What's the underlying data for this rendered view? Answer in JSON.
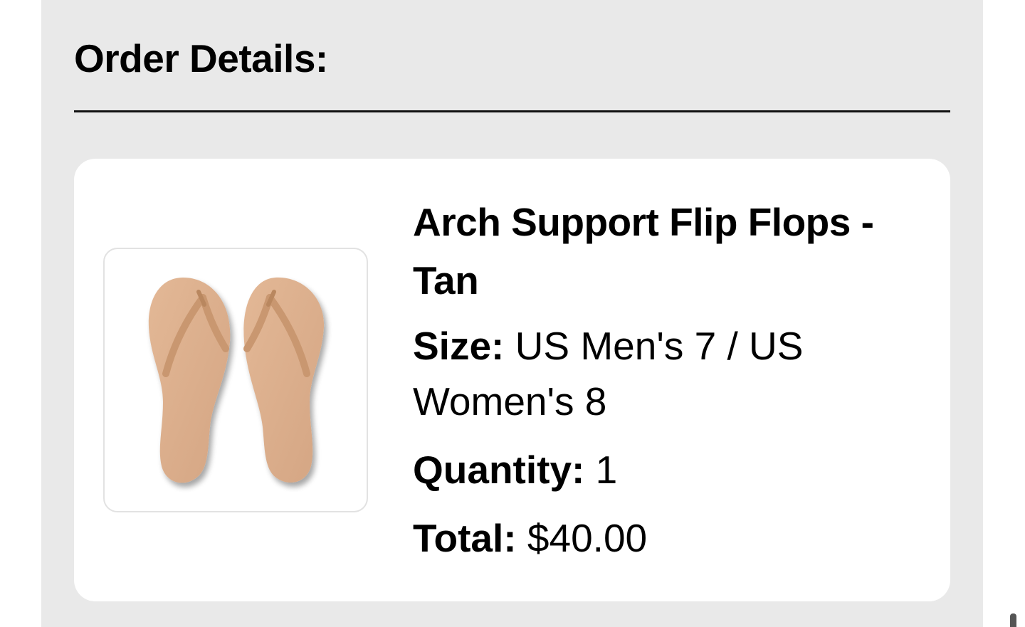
{
  "order": {
    "heading": "Order Details:",
    "item": {
      "name": "Arch Support Flip Flops - Tan",
      "size_label": "Size:",
      "size_value": "US Men's 7 / US Women's 8",
      "quantity_label": "Quantity:",
      "quantity_value": "1",
      "total_label": "Total:",
      "total_value": "$40.00",
      "image_icon": "flip-flops-product-image"
    }
  },
  "colors": {
    "panel_background": "#e9e9e9",
    "card_background": "#ffffff",
    "product_tan": "#dcae8c"
  }
}
